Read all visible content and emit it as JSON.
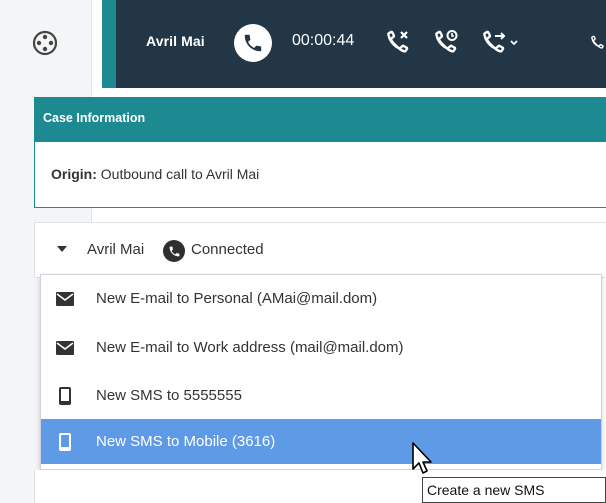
{
  "toolbar": {
    "caller_name": "Avril Mai",
    "timer": "00:00:44",
    "icons": [
      "phone-active-icon",
      "end-call-icon",
      "hold-call-icon",
      "transfer-call-icon",
      "consult-call-icon"
    ]
  },
  "case": {
    "header": "Case Information",
    "origin_label": "Origin:",
    "origin_value": "Outbound call to Avril Mai"
  },
  "party": {
    "name": "Avril Mai",
    "status": "Connected"
  },
  "menu": {
    "items": [
      {
        "label": "New E-mail to Personal (AMai@mail.dom)",
        "icon": "envelope-icon"
      },
      {
        "label": "New E-mail to Work address (mail@mail.dom)",
        "icon": "envelope-icon"
      },
      {
        "label": "New SMS to 5555555",
        "icon": "mobile-phone-icon"
      },
      {
        "label": "New SMS to Mobile (3616)",
        "icon": "mobile-phone-icon"
      }
    ],
    "selected_index": 3
  },
  "tooltip": {
    "text": "Create a new SMS"
  },
  "colors": {
    "toolbar_bg": "#223645",
    "teal_accent": "#1d8a91",
    "selection_bg": "#5e9ae6"
  }
}
